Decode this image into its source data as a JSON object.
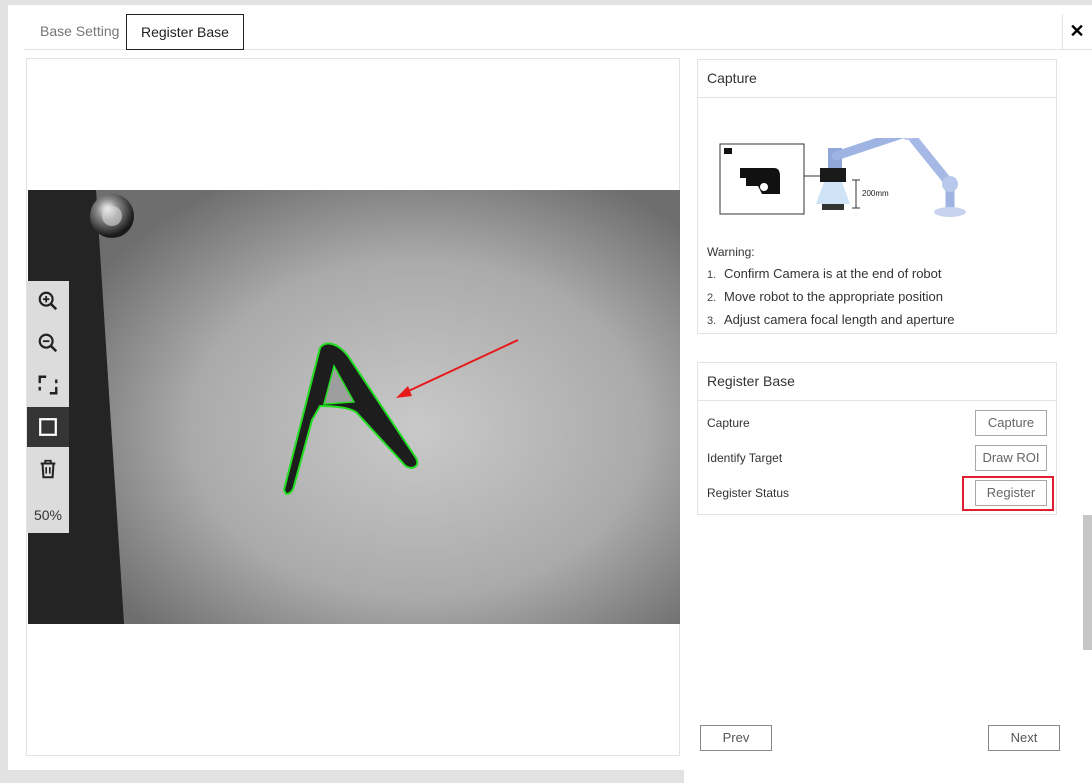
{
  "tabs": [
    {
      "label": "Base Setting",
      "active": false
    },
    {
      "label": "Register Base",
      "active": true
    }
  ],
  "close_icon": "close-icon",
  "viewer": {
    "zoom_text": "50%",
    "tools": [
      "zoom-in-icon",
      "zoom-out-icon",
      "fit-screen-icon",
      "rectangle-roi-icon",
      "trash-icon"
    ],
    "active_tool": "rectangle-roi-icon",
    "roi_color": "#22dd22",
    "arrow_color": "#e8191b"
  },
  "capture_card": {
    "title": "Capture",
    "illustration_label": "200mm",
    "warning_title": "Warning:",
    "warnings": [
      {
        "num": "1.",
        "text": "Confirm Camera is at the end of robot"
      },
      {
        "num": "2.",
        "text": "Move robot to the appropriate position"
      },
      {
        "num": "3.",
        "text": "Adjust camera focal length and aperture"
      }
    ]
  },
  "register_card": {
    "title": "Register Base",
    "rows": [
      {
        "label": "Capture",
        "button": "Capture"
      },
      {
        "label": "Identify Target",
        "button": "Draw ROI"
      },
      {
        "label": "Register Status",
        "button": "Register"
      }
    ],
    "highlight_color": "#e02030"
  },
  "nav": {
    "prev": "Prev",
    "next": "Next"
  }
}
